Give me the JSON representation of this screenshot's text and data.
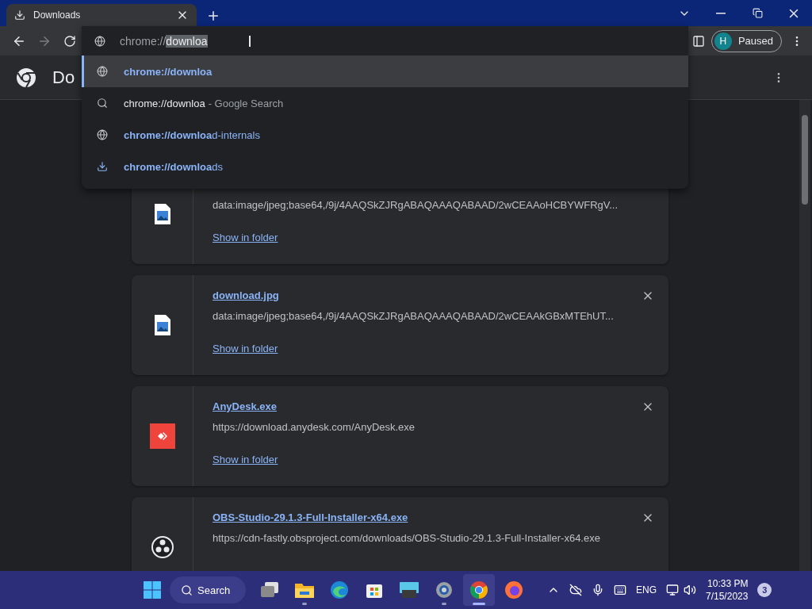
{
  "window": {
    "tab": {
      "title": "Downloads",
      "selected": true
    }
  },
  "toolbar": {
    "buttons": [
      {
        "kind": "back",
        "disabled": false
      },
      {
        "kind": "forward",
        "disabled": true
      },
      {
        "kind": "reload",
        "disabled": false
      }
    ]
  },
  "omnibox": {
    "value_typed": "chrome://",
    "value_selected": "downloa"
  },
  "suggestions": [
    {
      "kind": "url",
      "text": "**chrome://downloa**",
      "selected": true
    },
    {
      "kind": "search",
      "text": "chrome://downloa",
      "description": "- Google Search",
      "selected": false
    },
    {
      "kind": "url",
      "text": "**chrome://downloa**d-internals",
      "selected": false
    },
    {
      "kind": "download",
      "text": "**chrome://downloa**ds",
      "selected": false
    }
  ],
  "profile": {
    "initial": "H",
    "label": "Paused"
  },
  "page": {
    "title": "Do"
  },
  "downloads": [
    {
      "kind": "image",
      "url": "data:image/jpeg;base64,/9j/4AAQSkZJRgABAQAAAQABAAD/2wCEAAoHCBYWFRgV...",
      "action": "Show in folder"
    },
    {
      "kind": "image",
      "name": "download.jpg",
      "url": "data:image/jpeg;base64,/9j/4AAQSkZJRgABAQAAAQABAAD/2wCEAAkGBxMTEhUT...",
      "action": "Show in folder"
    },
    {
      "kind": "anydesk",
      "name": "AnyDesk.exe",
      "url": "https://download.anydesk.com/AnyDesk.exe",
      "action": "Show in folder"
    },
    {
      "kind": "obs",
      "name": "OBS-Studio-29.1.3-Full-Installer-x64.exe",
      "url": "https://cdn-fastly.obsproject.com/downloads/OBS-Studio-29.1.3-Full-Installer-x64.exe"
    }
  ],
  "taskbar": {
    "search": "Search",
    "apps": [
      {
        "kind": "taskview",
        "running": false,
        "selected": false
      },
      {
        "kind": "explorer",
        "running": true,
        "selected": false
      },
      {
        "kind": "edge",
        "running": false,
        "selected": false
      },
      {
        "kind": "store",
        "running": false,
        "selected": false
      },
      {
        "kind": "remote",
        "running": false,
        "selected": false
      },
      {
        "kind": "settings",
        "running": true,
        "selected": false
      },
      {
        "kind": "chrome",
        "running": true,
        "selected": true
      },
      {
        "kind": "firefox",
        "running": false,
        "selected": false
      }
    ]
  },
  "tray": {
    "language": "ENG",
    "time": "10:33 PM",
    "date": "7/15/2023",
    "notifications": "3"
  }
}
